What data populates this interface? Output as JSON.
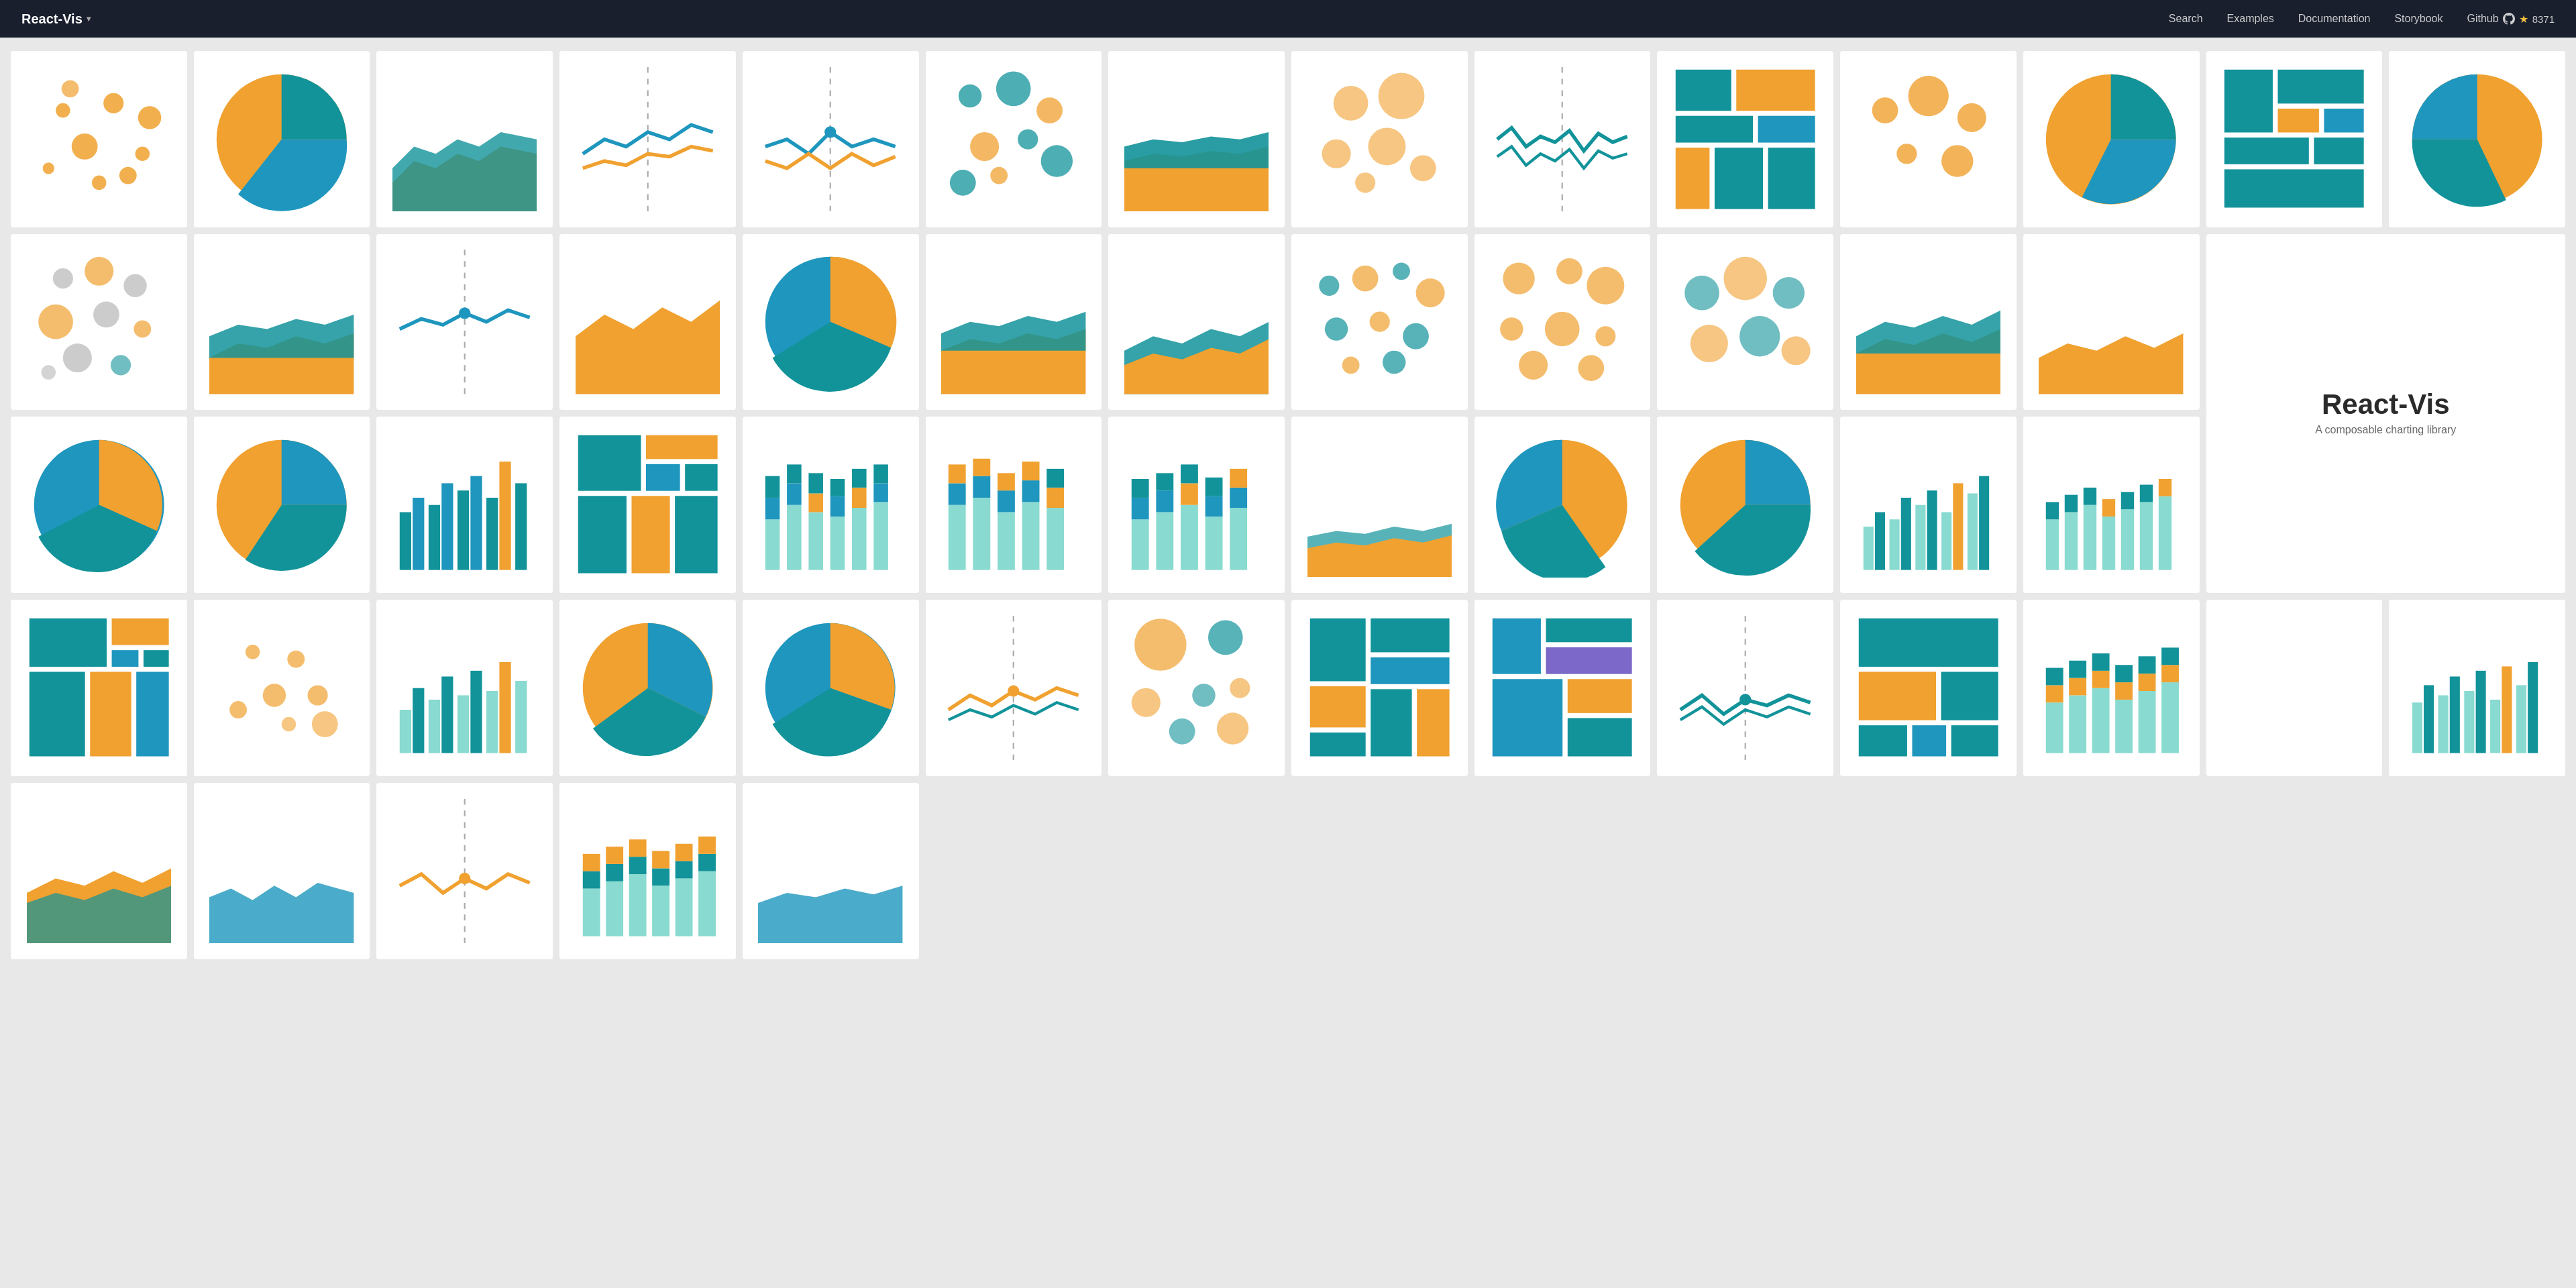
{
  "nav": {
    "brand": "React-Vis",
    "links": [
      {
        "label": "Search",
        "href": "#"
      },
      {
        "label": "Examples",
        "href": "#"
      },
      {
        "label": "Documentation",
        "href": "#"
      },
      {
        "label": "Storybook",
        "href": "#"
      },
      {
        "label": "Github",
        "href": "#"
      }
    ],
    "github_stars": "8371",
    "dropdown_char": "▾"
  },
  "hero": {
    "title": "React-Vis",
    "subtitle": "A composable charting library"
  }
}
